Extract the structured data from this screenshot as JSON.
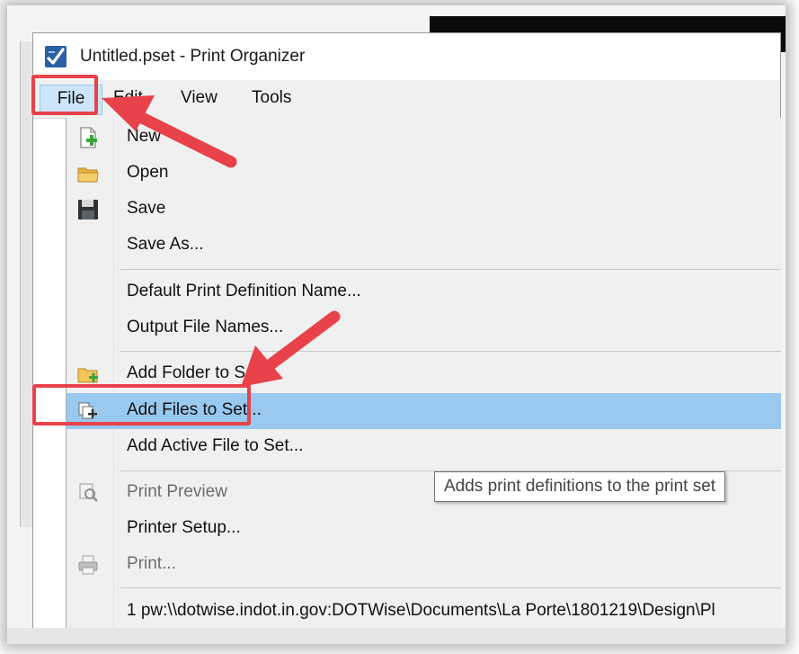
{
  "window": {
    "title": "Untitled.pset - Print Organizer",
    "app_icon": "print-organizer-icon"
  },
  "menubar": {
    "items": [
      {
        "label": "File",
        "active": true
      },
      {
        "label": "Edit"
      },
      {
        "label": "View"
      },
      {
        "label": "Tools"
      }
    ]
  },
  "file_menu": {
    "items": [
      {
        "label": "New",
        "icon": "new-document-icon",
        "enabled": true
      },
      {
        "label": "Open",
        "icon": "folder-open-icon",
        "enabled": true
      },
      {
        "label": "Save",
        "icon": "floppy-disk-icon",
        "enabled": true
      },
      {
        "label": "Save As...",
        "enabled": true
      },
      {
        "label": "Default Print Definition Name...",
        "enabled": true
      },
      {
        "label": "Output File Names...",
        "enabled": true
      },
      {
        "label": "Add Folder to Set",
        "icon": "add-folder-icon",
        "enabled": true
      },
      {
        "label": "Add Files to Set...",
        "icon": "add-files-icon",
        "enabled": true,
        "highlighted": true
      },
      {
        "label": "Add Active File to Set...",
        "enabled": true
      },
      {
        "label": "Print Preview",
        "icon": "print-preview-icon",
        "enabled": false
      },
      {
        "label": "Printer Setup...",
        "enabled": true
      },
      {
        "label": "Print...",
        "icon": "printer-icon",
        "enabled": false
      },
      {
        "label": "1 pw:\\\\dotwise.indot.in.gov:DOTWise\\Documents\\La Porte\\1801219\\Design\\Pl",
        "enabled": true
      }
    ]
  },
  "tooltip": {
    "text": "Adds print definitions to the print set"
  },
  "annotations": {
    "color": "#e8424a"
  }
}
